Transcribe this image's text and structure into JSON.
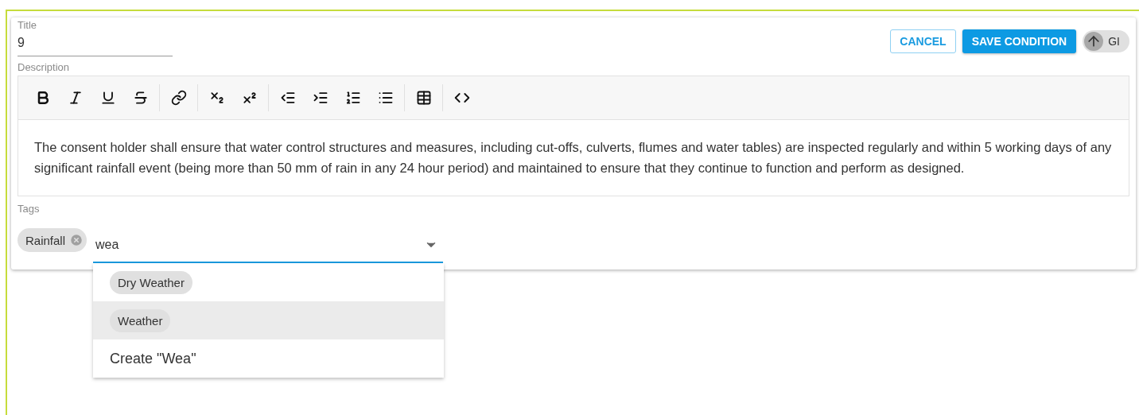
{
  "title_field": {
    "label": "Title",
    "value": "9"
  },
  "actions": {
    "cancel": "CANCEL",
    "save": "SAVE CONDITION",
    "toggle": {
      "label": "GI",
      "on": false
    }
  },
  "description": {
    "label": "Description",
    "toolbar": [
      {
        "kind": "bold"
      },
      {
        "kind": "italic"
      },
      {
        "kind": "underline"
      },
      {
        "kind": "strike",
        "group_end": true
      },
      {
        "kind": "link",
        "group_end": true
      },
      {
        "kind": "subscript"
      },
      {
        "kind": "superscript",
        "group_end": true
      },
      {
        "kind": "outdent"
      },
      {
        "kind": "indent"
      },
      {
        "kind": "ordered"
      },
      {
        "kind": "bullets",
        "group_end": true
      },
      {
        "kind": "table",
        "group_end": true
      },
      {
        "kind": "code"
      }
    ],
    "text": "The consent holder shall ensure that water control structures and measures, including cut-offs, culverts, flumes and water tables) are inspected regularly and within 5 working days of any significant rainfall event (being more than 50 mm of rain in any 24 hour period) and maintained to ensure that they continue to function and perform as designed."
  },
  "tags": {
    "label": "Tags",
    "chips": [
      "Rainfall"
    ],
    "input": "wea",
    "options": [
      {
        "label": "Dry Weather",
        "selected": false
      },
      {
        "label": "Weather",
        "selected": true
      }
    ],
    "create": "Create \"Wea\""
  }
}
